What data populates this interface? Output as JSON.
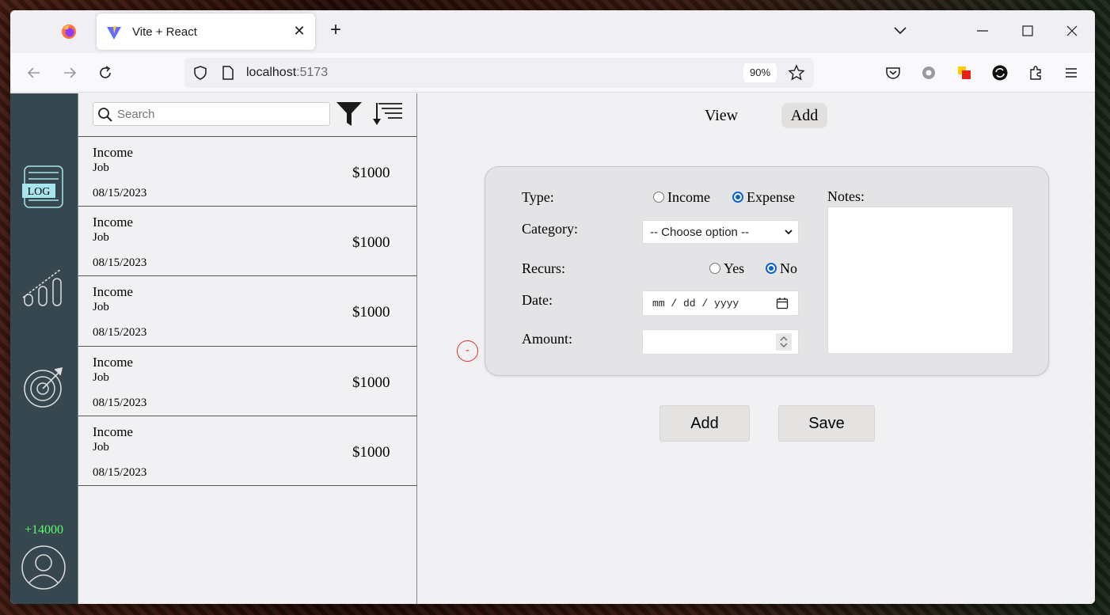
{
  "browser": {
    "tab_title": "Vite + React",
    "url_host": "localhost",
    "url_port": ":5173",
    "zoom": "90%"
  },
  "sidebar": {
    "log_label": "LOG",
    "balance": "+14000",
    "accent_color": "#5cff6a",
    "background_color": "#37474f"
  },
  "list": {
    "search_placeholder": "Search",
    "items": [
      {
        "type": "Income",
        "category": "Job",
        "amount": "$1000",
        "date": "08/15/2023"
      },
      {
        "type": "Income",
        "category": "Job",
        "amount": "$1000",
        "date": "08/15/2023"
      },
      {
        "type": "Income",
        "category": "Job",
        "amount": "$1000",
        "date": "08/15/2023"
      },
      {
        "type": "Income",
        "category": "Job",
        "amount": "$1000",
        "date": "08/15/2023"
      },
      {
        "type": "Income",
        "category": "Job",
        "amount": "$1000",
        "date": "08/15/2023"
      }
    ]
  },
  "main": {
    "tabs": {
      "view": "View",
      "add": "Add"
    },
    "remove_label": "-",
    "form": {
      "type_label": "Type:",
      "type_options": {
        "income": "Income",
        "expense": "Expense"
      },
      "type_selected": "Expense",
      "category_label": "Category:",
      "category_value": "-- Choose option --",
      "recurs_label": "Recurs:",
      "recurs_options": {
        "yes": "Yes",
        "no": "No"
      },
      "recurs_selected": "No",
      "date_label": "Date:",
      "date_placeholder": "mm / dd / yyyy",
      "amount_label": "Amount:",
      "notes_label": "Notes:"
    },
    "buttons": {
      "add": "Add",
      "save": "Save"
    }
  }
}
